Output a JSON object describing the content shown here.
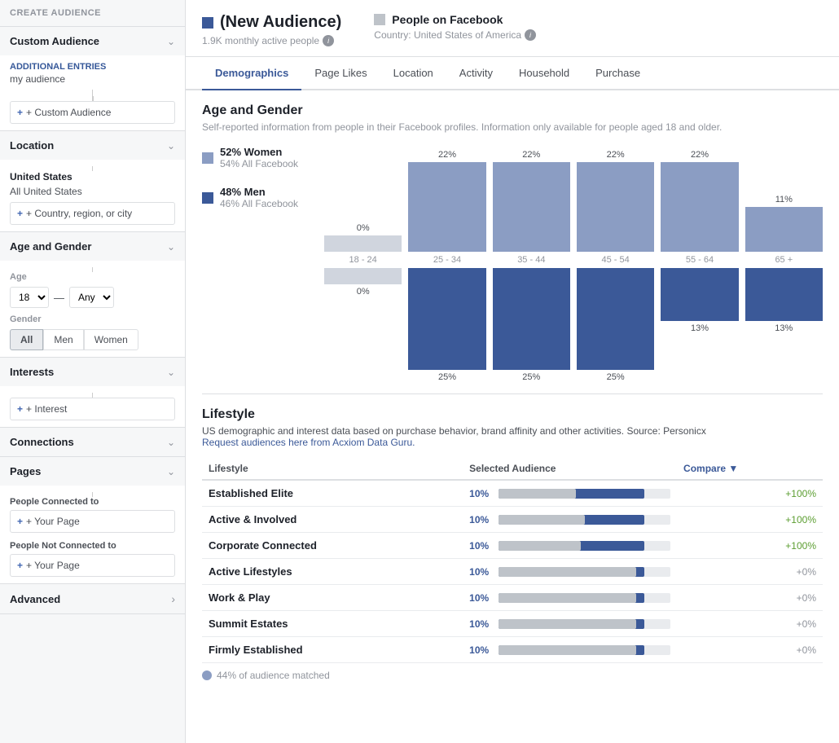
{
  "sidebar": {
    "header": "Create Audience",
    "custom_audience": {
      "label": "Custom Audience",
      "icon_label": "chevron"
    },
    "additional_entries": {
      "label": "Additional Entries",
      "sublabel": "my audience",
      "placeholder": "+ Custom Audience"
    },
    "location": {
      "label": "Location",
      "country": "United States",
      "region": "All United States",
      "placeholder": "+ Country, region, or city"
    },
    "age_gender": {
      "label": "Age and Gender",
      "age_label": "Age",
      "age_min": "18",
      "age_max": "Any",
      "gender_label": "Gender",
      "gender_options": [
        "All",
        "Men",
        "Women"
      ],
      "gender_active": "All"
    },
    "interests": {
      "label": "Interests",
      "placeholder": "+ Interest"
    },
    "connections": {
      "label": "Connections"
    },
    "pages": {
      "label": "Pages"
    },
    "people_connected": {
      "label": "People Connected to",
      "placeholder": "+ Your Page"
    },
    "people_not_connected": {
      "label": "People Not Connected to",
      "placeholder": "+ Your Page"
    },
    "advanced": {
      "label": "Advanced"
    }
  },
  "audience": {
    "title": "(New Audience)",
    "monthly_active": "1.9K monthly active people",
    "people_label": "People on Facebook",
    "country": "Country: United States of America",
    "info_icon": "i"
  },
  "tabs": [
    "Demographics",
    "Page Likes",
    "Location",
    "Activity",
    "Household",
    "Purchase"
  ],
  "active_tab": "Demographics",
  "age_gender_section": {
    "title": "Age and Gender",
    "description": "Self-reported information from people in their Facebook profiles. Information only available for people aged 18 and older.",
    "women": {
      "pct": "52% Women",
      "sub": "54% All Facebook",
      "color": "#8b9dc3"
    },
    "men": {
      "pct": "48% Men",
      "sub": "46% All Facebook",
      "color": "#3b5998"
    },
    "bars": [
      {
        "age": "18 - 24",
        "women_pct": "0%",
        "men_pct": "0%",
        "women_height": 20,
        "men_height": 20
      },
      {
        "age": "25 - 34",
        "women_pct": "22%",
        "men_pct": "25%",
        "women_height": 110,
        "men_height": 125
      },
      {
        "age": "35 - 44",
        "women_pct": "22%",
        "men_pct": "25%",
        "women_height": 110,
        "men_height": 125
      },
      {
        "age": "45 - 54",
        "women_pct": "22%",
        "men_pct": "25%",
        "women_height": 110,
        "men_height": 125
      },
      {
        "age": "55 - 64",
        "women_pct": "22%",
        "men_pct": "13%",
        "women_height": 110,
        "men_height": 65
      },
      {
        "age": "65 +",
        "women_pct": "11%",
        "men_pct": "13%",
        "women_height": 55,
        "men_height": 65
      }
    ]
  },
  "lifestyle_section": {
    "title": "Lifestyle",
    "desc1": "US demographic and interest data based on purchase behavior, brand affinity and other activities. Source: Personicx",
    "link_text": "Request audiences here from Acxiom Data Guru.",
    "columns": [
      "Lifestyle",
      "Selected Audience",
      "Compare"
    ],
    "rows": [
      {
        "name": "Established Elite",
        "pct": "10%",
        "bar_dark": 85,
        "bar_light": 45,
        "compare": "+100%",
        "positive": true
      },
      {
        "name": "Active & Involved",
        "pct": "10%",
        "bar_dark": 85,
        "bar_light": 50,
        "compare": "+100%",
        "positive": true
      },
      {
        "name": "Corporate Connected",
        "pct": "10%",
        "bar_dark": 85,
        "bar_light": 48,
        "compare": "+100%",
        "positive": true
      },
      {
        "name": "Active Lifestyles",
        "pct": "10%",
        "bar_dark": 85,
        "bar_light": 80,
        "compare": "+0%",
        "positive": false
      },
      {
        "name": "Work & Play",
        "pct": "10%",
        "bar_dark": 85,
        "bar_light": 80,
        "compare": "+0%",
        "positive": false
      },
      {
        "name": "Summit Estates",
        "pct": "10%",
        "bar_dark": 85,
        "bar_light": 80,
        "compare": "+0%",
        "positive": false
      },
      {
        "name": "Firmly Established",
        "pct": "10%",
        "bar_dark": 85,
        "bar_light": 80,
        "compare": "+0%",
        "positive": false
      }
    ],
    "matched": "44% of audience matched"
  }
}
